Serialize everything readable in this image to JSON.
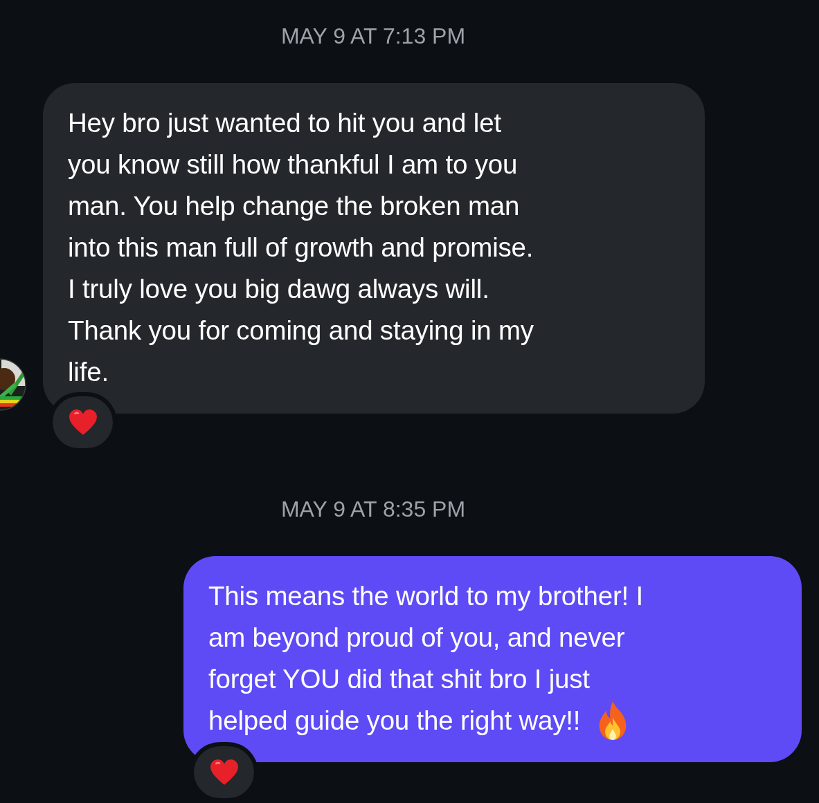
{
  "messages": [
    {
      "timestamp": "MAY 9 AT 7:13 PM",
      "kind": "received",
      "lines": [
        "Hey bro just wanted to hit you and let",
        "you know still how thankful I am to you",
        "man. You help change the broken man",
        "into this man full of growth and promise.",
        "I truly love you big dawg always will.",
        "Thank you for coming and staying in my",
        "life."
      ],
      "reaction": {
        "kind": "heart"
      }
    },
    {
      "timestamp": "MAY 9 AT 8:35 PM",
      "kind": "sent",
      "lines": [
        "This means the world to my brother! I",
        "am beyond proud of you, and never",
        "forget YOU did that shit bro I just",
        "helped guide you the right way!!"
      ],
      "trailing_icon": {
        "kind": "fire"
      },
      "reaction": {
        "kind": "heart"
      }
    }
  ]
}
